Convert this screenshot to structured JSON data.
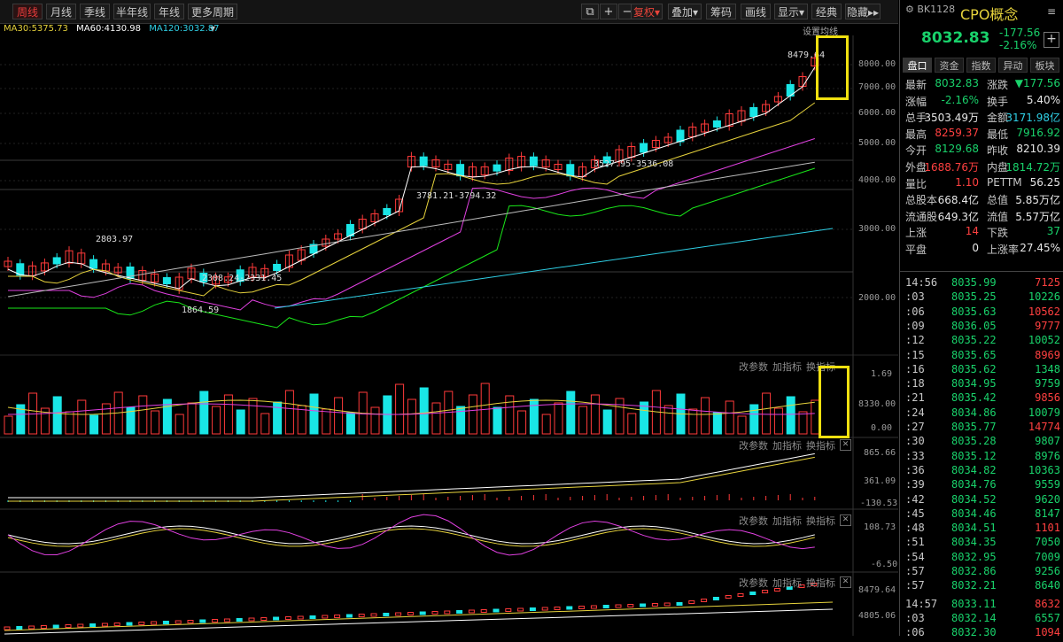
{
  "toolbar": {
    "periods": [
      "周线",
      "月线",
      "季线",
      "半年线",
      "年线",
      "更多周期"
    ],
    "active_period": "周线",
    "right_buttons": [
      "复权",
      "叠加",
      "筹码",
      "画线",
      "显示",
      "经典",
      "隐藏"
    ]
  },
  "ma_legend": [
    {
      "label": "MA30:5375.73",
      "color": "#2fd0e6"
    },
    {
      "label": "MA60:4130.98",
      "color": "#ffffff"
    },
    {
      "label": "MA120:3032.87",
      "color": "#2fd0e6"
    }
  ],
  "chart_annotations": {
    "set_ma": "设置均线",
    "high": "8479.64",
    "h2": "2803.97",
    "low": "1864.59",
    "range1": "2308.24-2331.45",
    "range2": "3781.21-3794.32",
    "range3": "3527.95-3536.08"
  },
  "price_axis": [
    "8000.00",
    "7000.00",
    "6000.00",
    "5000.00",
    "4000.00",
    "3000.00",
    "2000.00"
  ],
  "vol_axis": [
    "1.69",
    "8330.00",
    "0.00"
  ],
  "macd_axis": [
    "865.66",
    "361.09",
    "-130.53"
  ],
  "kdj_axis": [
    "108.73",
    "-6.50"
  ],
  "mini_axis": [
    "8479.64",
    "4805.06"
  ],
  "panel_buttons": {
    "params": "改参数",
    "add": "加指标",
    "switch": "换指标"
  },
  "quote": {
    "code": "BK1128",
    "name": "CPO概念",
    "price": "8032.83",
    "change": "-177.56",
    "pct": "-2.16%",
    "tabs": [
      "盘口",
      "资金",
      "指数",
      "异动",
      "板块"
    ],
    "rows": [
      {
        "k": "最新",
        "v": "8032.83",
        "vc": "green",
        "k2": "涨跌",
        "v2": "▼177.56",
        "v2c": "green"
      },
      {
        "k": "涨幅",
        "v": "-2.16%",
        "vc": "green",
        "k2": "换手",
        "v2": "5.40%",
        "v2c": "white"
      },
      {
        "k": "总手",
        "v": "3503.49万",
        "vc": "white",
        "k2": "金额",
        "v2": "3171.98亿",
        "v2c": "cyan"
      },
      {
        "k": "最高",
        "v": "8259.37",
        "vc": "red",
        "k2": "最低",
        "v2": "7916.92",
        "v2c": "green"
      },
      {
        "k": "今开",
        "v": "8129.68",
        "vc": "green",
        "k2": "昨收",
        "v2": "8210.39",
        "v2c": "white"
      },
      {
        "k": "外盘",
        "v": "1688.76万",
        "vc": "red",
        "k2": "内盘",
        "v2": "1814.72万",
        "v2c": "green"
      },
      {
        "k": "量比",
        "v": "1.10",
        "vc": "red",
        "k2": "PETTM",
        "v2": "56.25",
        "v2c": "white"
      },
      {
        "k": "总股本",
        "v": "668.4亿",
        "vc": "white",
        "k2": "总值",
        "v2": "5.85万亿",
        "v2c": "white"
      },
      {
        "k": "流通股",
        "v": "649.3亿",
        "vc": "white",
        "k2": "流值",
        "v2": "5.57万亿",
        "v2c": "white"
      },
      {
        "k": "上涨",
        "v": "14",
        "vc": "red",
        "k2": "下跌",
        "v2": "37",
        "v2c": "green"
      },
      {
        "k": "平盘",
        "v": "0",
        "vc": "white",
        "k2": "上涨率",
        "v2": "27.45%",
        "v2c": "white"
      }
    ],
    "ticks": [
      {
        "t": "14:56",
        "p": "8035.99",
        "v": "7125",
        "vc": "red"
      },
      {
        "t": ":03",
        "p": "8035.25",
        "v": "10226",
        "vc": "green"
      },
      {
        "t": ":06",
        "p": "8035.63",
        "v": "10562",
        "vc": "red"
      },
      {
        "t": ":09",
        "p": "8036.05",
        "v": "9777",
        "vc": "red"
      },
      {
        "t": ":12",
        "p": "8035.22",
        "v": "10052",
        "vc": "green"
      },
      {
        "t": ":15",
        "p": "8035.65",
        "v": "8969",
        "vc": "red"
      },
      {
        "t": ":16",
        "p": "8035.62",
        "v": "1348",
        "vc": "green"
      },
      {
        "t": ":18",
        "p": "8034.95",
        "v": "9759",
        "vc": "green"
      },
      {
        "t": ":21",
        "p": "8035.42",
        "v": "9856",
        "vc": "red"
      },
      {
        "t": ":24",
        "p": "8034.86",
        "v": "10079",
        "vc": "green"
      },
      {
        "t": ":27",
        "p": "8035.77",
        "v": "14774",
        "vc": "red"
      },
      {
        "t": ":30",
        "p": "8035.28",
        "v": "9807",
        "vc": "green"
      },
      {
        "t": ":33",
        "p": "8035.12",
        "v": "8976",
        "vc": "green"
      },
      {
        "t": ":36",
        "p": "8034.82",
        "v": "10363",
        "vc": "green"
      },
      {
        "t": ":39",
        "p": "8034.76",
        "v": "9559",
        "vc": "green"
      },
      {
        "t": ":42",
        "p": "8034.52",
        "v": "9620",
        "vc": "green"
      },
      {
        "t": ":45",
        "p": "8034.46",
        "v": "8147",
        "vc": "green"
      },
      {
        "t": ":48",
        "p": "8034.51",
        "v": "1101",
        "vc": "red"
      },
      {
        "t": ":51",
        "p": "8034.35",
        "v": "7050",
        "vc": "green"
      },
      {
        "t": ":54",
        "p": "8032.95",
        "v": "7009",
        "vc": "green"
      },
      {
        "t": ":57",
        "p": "8032.86",
        "v": "9256",
        "vc": "green"
      },
      {
        "t": ":57",
        "p": "8032.21",
        "v": "8640",
        "vc": "green"
      },
      {
        "t": "14:57",
        "p": "8033.11",
        "v": "8632",
        "vc": "red"
      },
      {
        "t": ":03",
        "p": "8032.14",
        "v": "6557",
        "vc": "green"
      },
      {
        "t": ":06",
        "p": "8032.30",
        "v": "1094",
        "vc": "red"
      }
    ]
  }
}
